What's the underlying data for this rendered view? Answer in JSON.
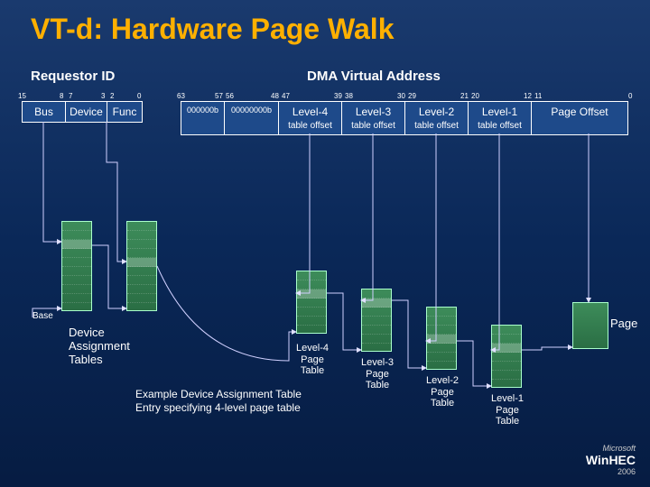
{
  "title": "VT-d: Hardware Page Walk",
  "requestor": {
    "label": "Requestor ID",
    "bits": [
      "15",
      "8",
      "7",
      "3",
      "2",
      "0"
    ],
    "fields": {
      "bus": "Bus",
      "device": "Device",
      "func": "Func"
    }
  },
  "dva": {
    "label": "DMA Virtual Address",
    "bits": [
      "63",
      "57",
      "56",
      "48",
      "47",
      "39",
      "38",
      "30",
      "29",
      "21",
      "20",
      "12",
      "11",
      "0"
    ],
    "fields": {
      "z1": "000000b",
      "z2": "00000000b",
      "l4a": "Level-4",
      "l4b": "table offset",
      "l3a": "Level-3",
      "l3b": "table offset",
      "l2a": "Level-2",
      "l2b": "table offset",
      "l1a": "Level-1",
      "l1b": "table offset",
      "po": "Page Offset"
    }
  },
  "base_label": "Base",
  "dat_label": "Device\nAssignment\nTables",
  "caption": "Example Device Assignment Table Entry specifying 4-level page table",
  "page_label": "Page",
  "levels": {
    "l4": "Level-4\nPage\nTable",
    "l3": "Level-3\nPage\nTable",
    "l2": "Level-2\nPage\nTable",
    "l1": "Level-1\nPage\nTable"
  },
  "footer": {
    "ms": "Microsoft",
    "event": "WinHEC",
    "year": "2006"
  }
}
